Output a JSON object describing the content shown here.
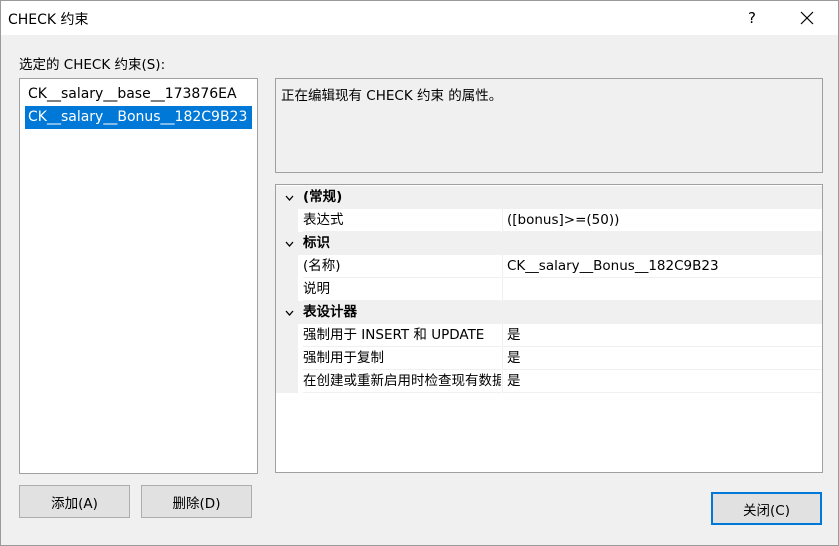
{
  "window": {
    "title": "CHECK 约束",
    "help_glyph": "?"
  },
  "list": {
    "label": "选定的 CHECK 约束(S):",
    "items": [
      {
        "label": "CK__salary__base__173876EA",
        "selected": false
      },
      {
        "label": "CK__salary__Bonus__182C9B23",
        "selected": true
      }
    ]
  },
  "description": "正在编辑现有 CHECK 约束 的属性。",
  "properties": {
    "cat_general": {
      "label": "(常规)",
      "expanded": true
    },
    "expression": {
      "name": "表达式",
      "value": "([bonus]>=(50))"
    },
    "cat_identity": {
      "label": "标识",
      "expanded": true
    },
    "name_prop": {
      "name": "(名称)",
      "value": "CK__salary__Bonus__182C9B23"
    },
    "desc_prop": {
      "name": "说明",
      "value": ""
    },
    "cat_designer": {
      "label": "表设计器",
      "expanded": true
    },
    "enforce_insert_update": {
      "name": "强制用于 INSERT 和 UPDATE",
      "value": "是"
    },
    "enforce_replication": {
      "name": "强制用于复制",
      "value": "是"
    },
    "check_existing": {
      "name": "在创建或重新启用时检查现有数据",
      "value": "是"
    }
  },
  "buttons": {
    "add": "添加(A)",
    "delete": "删除(D)",
    "close": "关闭(C)"
  },
  "colors": {
    "selection": "#0078d7",
    "dialog_bg": "#f0f0f0"
  },
  "icons": {
    "close": "close-icon",
    "collapse": "chevron-down-icon"
  }
}
